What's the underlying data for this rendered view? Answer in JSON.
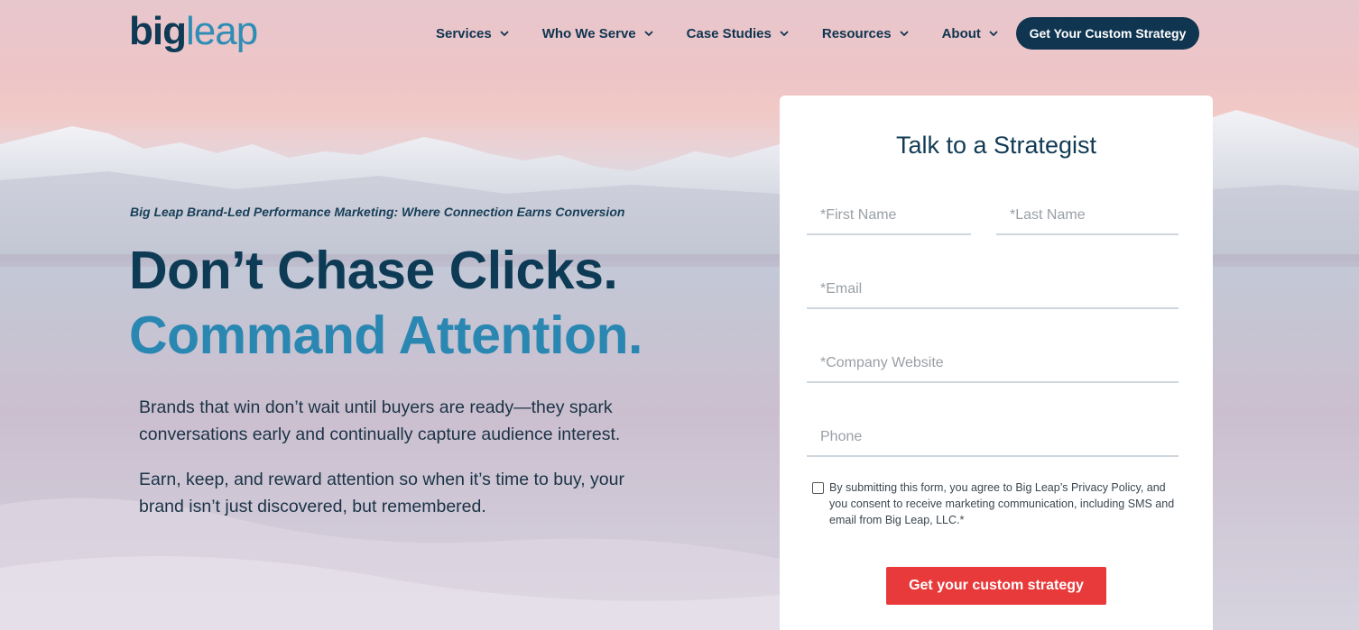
{
  "brand": {
    "logo_big": "big",
    "logo_leap": "leap"
  },
  "nav": {
    "items": [
      {
        "label": "Services"
      },
      {
        "label": "Who We Serve"
      },
      {
        "label": "Case Studies"
      },
      {
        "label": "Resources"
      },
      {
        "label": "About"
      }
    ],
    "cta_label": "Get Your Custom Strategy"
  },
  "hero": {
    "eyebrow": "Big Leap Brand-Led Performance Marketing: Where Connection Earns Conversion",
    "headline_line1": "Don’t Chase Clicks.",
    "headline_line2": "Command Attention.",
    "paragraph1": "Brands that win don’t wait until buyers are ready—they spark conversations early and continually capture audience interest.",
    "paragraph2": "Earn, keep, and reward attention so when it’s time to buy, your brand isn’t just discovered, but remembered."
  },
  "form": {
    "title": "Talk to a Strategist",
    "first_name_placeholder": "*First Name",
    "last_name_placeholder": "*Last Name",
    "email_placeholder": "*Email",
    "website_placeholder": "*Company Website",
    "phone_placeholder": "Phone",
    "consent_text": "By submitting this form, you agree to Big Leap’s Privacy Policy, and you consent to receive marketing communication, including SMS and email from Big Leap, LLC.*",
    "consent_checked": false,
    "submit_label": "Get your custom strategy"
  },
  "colors": {
    "navy": "#0f3550",
    "accent_blue": "#2a87b2",
    "submit_red": "#e83a3a"
  },
  "icons": {
    "nav_dropdown": "chevron-down-icon"
  }
}
